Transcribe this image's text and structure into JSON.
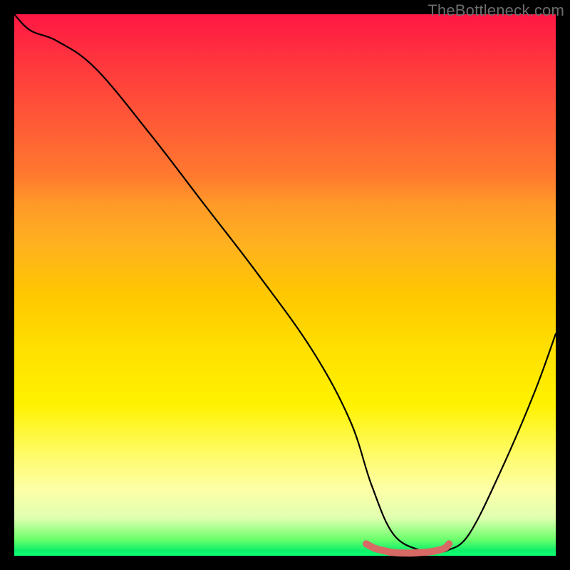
{
  "watermark": "TheBottleneck.com",
  "chart_data": {
    "type": "line",
    "title": "",
    "xlabel": "",
    "ylabel": "",
    "xlim": [
      0,
      100
    ],
    "ylim": [
      0,
      100
    ],
    "series": [
      {
        "name": "bottleneck-curve",
        "x": [
          0,
          3,
          8,
          15,
          25,
          35,
          45,
          55,
          62,
          66,
          70,
          75,
          78,
          80,
          84,
          90,
          96,
          100
        ],
        "values": [
          100,
          97,
          95,
          90,
          78,
          65,
          52,
          38,
          25,
          13,
          4,
          1,
          1,
          1,
          4,
          16,
          30,
          41
        ]
      },
      {
        "name": "sweet-spot",
        "x": [
          65.0,
          66.5,
          68.0,
          70.0,
          73.0,
          75.0,
          76.5,
          77.8,
          79.5,
          80.3
        ],
        "values": [
          2.2,
          1.4,
          1.0,
          0.6,
          0.5,
          0.6,
          0.7,
          0.9,
          1.4,
          2.2
        ]
      }
    ],
    "colors": {
      "curve": "#000000",
      "sweet_spot": "#d86a66",
      "gradient_top": "#ff1744",
      "gradient_mid": "#ffe000",
      "gradient_bottom": "#0dff72",
      "frame": "#000000"
    }
  }
}
